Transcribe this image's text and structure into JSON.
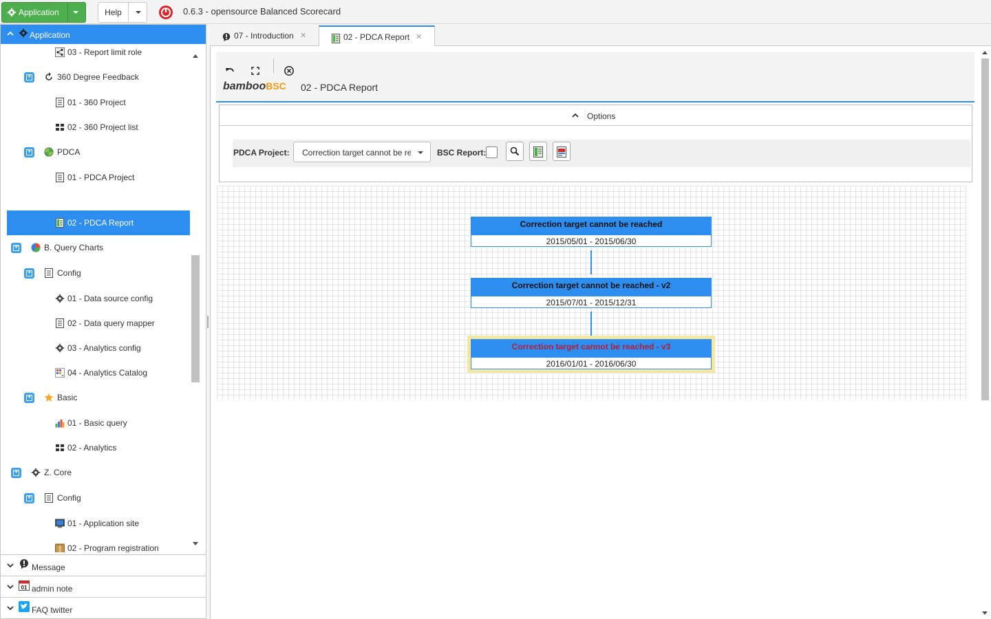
{
  "topbar": {
    "application_label": "Application",
    "help_label": "Help",
    "title": "0.6.3 - opensource Balanced Scorecard"
  },
  "sidebar": {
    "header_label": "Application",
    "items": [
      {
        "label": "03 - Report limit role"
      },
      {
        "label": "360 Degree Feedback"
      },
      {
        "label": "01 - 360 Project"
      },
      {
        "label": "02 - 360 Project list"
      },
      {
        "label": "PDCA"
      },
      {
        "label": "01 - PDCA Project"
      },
      {
        "label": "02 - PDCA Report"
      },
      {
        "label": "B. Query Charts"
      },
      {
        "label": "Config"
      },
      {
        "label": "01 - Data source config"
      },
      {
        "label": "02 - Data query mapper"
      },
      {
        "label": "03 - Analytics config"
      },
      {
        "label": "04 - Analytics Catalog"
      },
      {
        "label": "Basic"
      },
      {
        "label": "01 - Basic query"
      },
      {
        "label": "02 - Analytics"
      },
      {
        "label": "Z. Core"
      },
      {
        "label": "Config"
      },
      {
        "label": "01 - Application site"
      },
      {
        "label": "02 - Program registration"
      }
    ],
    "panels": [
      {
        "label": "Message"
      },
      {
        "label": "admin note"
      },
      {
        "label": "FAQ twitter"
      }
    ]
  },
  "tabs": [
    {
      "label": "07 - Introduction"
    },
    {
      "label": "02 - PDCA Report"
    }
  ],
  "toolbar": {
    "brand_main": "bamboo",
    "brand_accent": "BSC",
    "page_title": "02 - PDCA Report"
  },
  "options": {
    "header_label": "Options",
    "pdca_project_label": "PDCA Project:",
    "pdca_project_value": "Correction target cannot be reached",
    "bsc_report_label": "BSC Report:"
  },
  "pdca_chain": [
    {
      "title": "Correction target cannot be reached",
      "period": "2015/05/01 - 2015/06/30"
    },
    {
      "title": "Correction target cannot be reached - v2",
      "period": "2015/07/01 - 2015/12/31"
    },
    {
      "title": "Correction target cannot be reached - v3",
      "period": "2016/01/01 - 2016/06/30"
    }
  ],
  "colors": {
    "accent": "#2d8ef0",
    "app_button": "#4cae4c",
    "highlight_title": "#b0203a",
    "brand_accent": "#f39c12"
  }
}
